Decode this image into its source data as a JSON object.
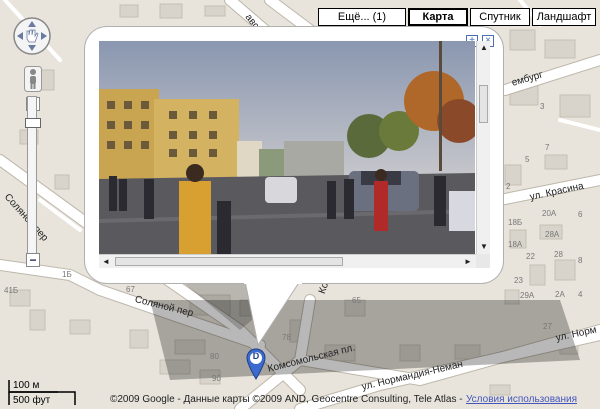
{
  "map_types": {
    "more": "Ещё... (1)",
    "map": "Карта",
    "satellite": "Спутник",
    "terrain": "Ландшафт",
    "active": "Карта"
  },
  "streets": {
    "solyanoy_left": "Соляной пер",
    "solyanoy_bottom": "Соляной пер",
    "komsomolskaya": "Комсомольская пл.",
    "normandiya": "ул. Нормандия-Неман",
    "normandiya_right": "ул. Норм",
    "krasina": "ул. Красина",
    "embourg": "ембург",
    "avskaya": "авская",
    "ko": "Ко"
  },
  "house_numbers": {
    "n1": "1Б",
    "n2": "41Б",
    "n3": "67",
    "n4": "78А",
    "n5": "78",
    "n6": "65",
    "n7": "80",
    "n8": "77",
    "n9": "90",
    "n10": "18А",
    "n11": "20А",
    "n12": "28А",
    "n13": "18Б",
    "n14": "22",
    "n15": "28",
    "n16": "23",
    "n17": "29А",
    "n18": "27",
    "n19": "7",
    "n20": "5",
    "n21": "2",
    "n22": "3",
    "n23": "6",
    "n24": "8",
    "n25": "4",
    "n26": "2А"
  },
  "marker_letter": "D",
  "scale": {
    "metric": "100 м",
    "imperial": "500 фут"
  },
  "copyright": "©2009 Google - Данные карты ©2009 AND, Geocentre Consulting, Tele Atlas -",
  "terms": "Условия использования",
  "colors": {
    "map_bg": "#e8e4dc",
    "road": "#ffffff",
    "road_edge": "#bdb6aa",
    "building": "#d6d2ca",
    "marker": "#3c6bd0"
  }
}
